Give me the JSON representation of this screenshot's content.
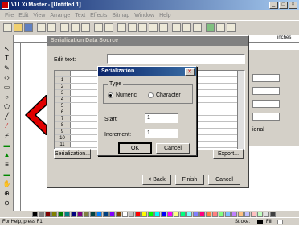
{
  "app": {
    "title": "VI LXi Master - [Untitled 1]"
  },
  "menu": [
    "File",
    "Edit",
    "View",
    "Arrange",
    "Text",
    "Effects",
    "Bitmap",
    "Window",
    "Help"
  ],
  "ruler": {
    "unit_label": "inches"
  },
  "wizard": {
    "title": "Serialization Data Source",
    "edit_text_label": "Edit text:",
    "row_numbers": [
      "1",
      "2",
      "3",
      "4",
      "5",
      "6",
      "7",
      "8",
      "9",
      "10",
      "11"
    ],
    "serialization_button": "Serialization...",
    "export_button": "Export...",
    "back_button": "< Back",
    "finish_button": "Finish",
    "cancel_button": "Cancel"
  },
  "dialog": {
    "title": "Serialization",
    "type_group": "Type",
    "numeric_label": "Numeric",
    "character_label": "Character",
    "start_label": "Start:",
    "start_value": "1",
    "increment_label": "Increment:",
    "increment_value": "1",
    "ok_button": "OK",
    "cancel_button": "Cancel"
  },
  "right_panel": {
    "partial_label": "ional"
  },
  "palette_colors": [
    "#000000",
    "#808080",
    "#800000",
    "#808000",
    "#008000",
    "#008080",
    "#000080",
    "#800080",
    "#808040",
    "#004040",
    "#0080ff",
    "#004080",
    "#8000ff",
    "#804000",
    "#ffffff",
    "#c0c0c0",
    "#ff0000",
    "#ffff00",
    "#00ff00",
    "#00ffff",
    "#0000ff",
    "#ff00ff",
    "#ffff80",
    "#00ff80",
    "#80ffff",
    "#8080ff",
    "#ff0080",
    "#ff8040",
    "#ff8080",
    "#80ff80",
    "#80c0ff",
    "#c080ff",
    "#ffc080",
    "#c0c0ff",
    "#ffc0c0",
    "#c0ffc0",
    "#e0e0e0",
    "#404040"
  ],
  "status": {
    "help_text": "For Help, press F1",
    "stroke_label": "Stroke:",
    "fill_label": "Fill"
  }
}
